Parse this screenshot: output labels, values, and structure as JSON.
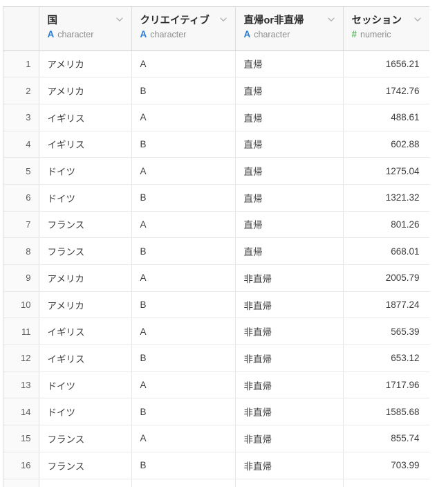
{
  "grid": {
    "rownum_header": "",
    "columns": [
      {
        "label": "国",
        "type_glyph": "A",
        "type_kind": "char",
        "type_label": "character",
        "align": "left",
        "menu_icon": "chevron-down-icon"
      },
      {
        "label": "クリエイティブ",
        "type_glyph": "A",
        "type_kind": "char",
        "type_label": "character",
        "align": "left",
        "menu_icon": "chevron-down-icon"
      },
      {
        "label": "直帰or非直帰",
        "type_glyph": "A",
        "type_kind": "char",
        "type_label": "character",
        "align": "left",
        "menu_icon": "chevron-down-icon"
      },
      {
        "label": "セッション",
        "type_glyph": "#",
        "type_kind": "num",
        "type_label": "numeric",
        "align": "right",
        "menu_icon": "chevron-down-icon"
      }
    ],
    "rows": [
      {
        "n": "1",
        "cells": [
          "アメリカ",
          "A",
          "直帰",
          "1656.21"
        ]
      },
      {
        "n": "2",
        "cells": [
          "アメリカ",
          "B",
          "直帰",
          "1742.76"
        ]
      },
      {
        "n": "3",
        "cells": [
          "イギリス",
          "A",
          "直帰",
          "488.61"
        ]
      },
      {
        "n": "4",
        "cells": [
          "イギリス",
          "B",
          "直帰",
          "602.88"
        ]
      },
      {
        "n": "5",
        "cells": [
          "ドイツ",
          "A",
          "直帰",
          "1275.04"
        ]
      },
      {
        "n": "6",
        "cells": [
          "ドイツ",
          "B",
          "直帰",
          "1321.32"
        ]
      },
      {
        "n": "7",
        "cells": [
          "フランス",
          "A",
          "直帰",
          "801.26"
        ]
      },
      {
        "n": "8",
        "cells": [
          "フランス",
          "B",
          "直帰",
          "668.01"
        ]
      },
      {
        "n": "9",
        "cells": [
          "アメリカ",
          "A",
          "非直帰",
          "2005.79"
        ]
      },
      {
        "n": "10",
        "cells": [
          "アメリカ",
          "B",
          "非直帰",
          "1877.24"
        ]
      },
      {
        "n": "11",
        "cells": [
          "イギリス",
          "A",
          "非直帰",
          "565.39"
        ]
      },
      {
        "n": "12",
        "cells": [
          "イギリス",
          "B",
          "非直帰",
          "653.12"
        ]
      },
      {
        "n": "13",
        "cells": [
          "ドイツ",
          "A",
          "非直帰",
          "1717.96"
        ]
      },
      {
        "n": "14",
        "cells": [
          "ドイツ",
          "B",
          "非直帰",
          "1585.68"
        ]
      },
      {
        "n": "15",
        "cells": [
          "フランス",
          "A",
          "非直帰",
          "855.74"
        ]
      },
      {
        "n": "16",
        "cells": [
          "フランス",
          "B",
          "非直帰",
          "703.99"
        ]
      }
    ]
  },
  "colors": {
    "character_type": "#2b7bd4",
    "numeric_type": "#5cb85c",
    "header_bg": "#f8f8f8",
    "rownum_bg": "#fafafa",
    "border": "#e6e6e6",
    "text": "#3c3c3c"
  }
}
